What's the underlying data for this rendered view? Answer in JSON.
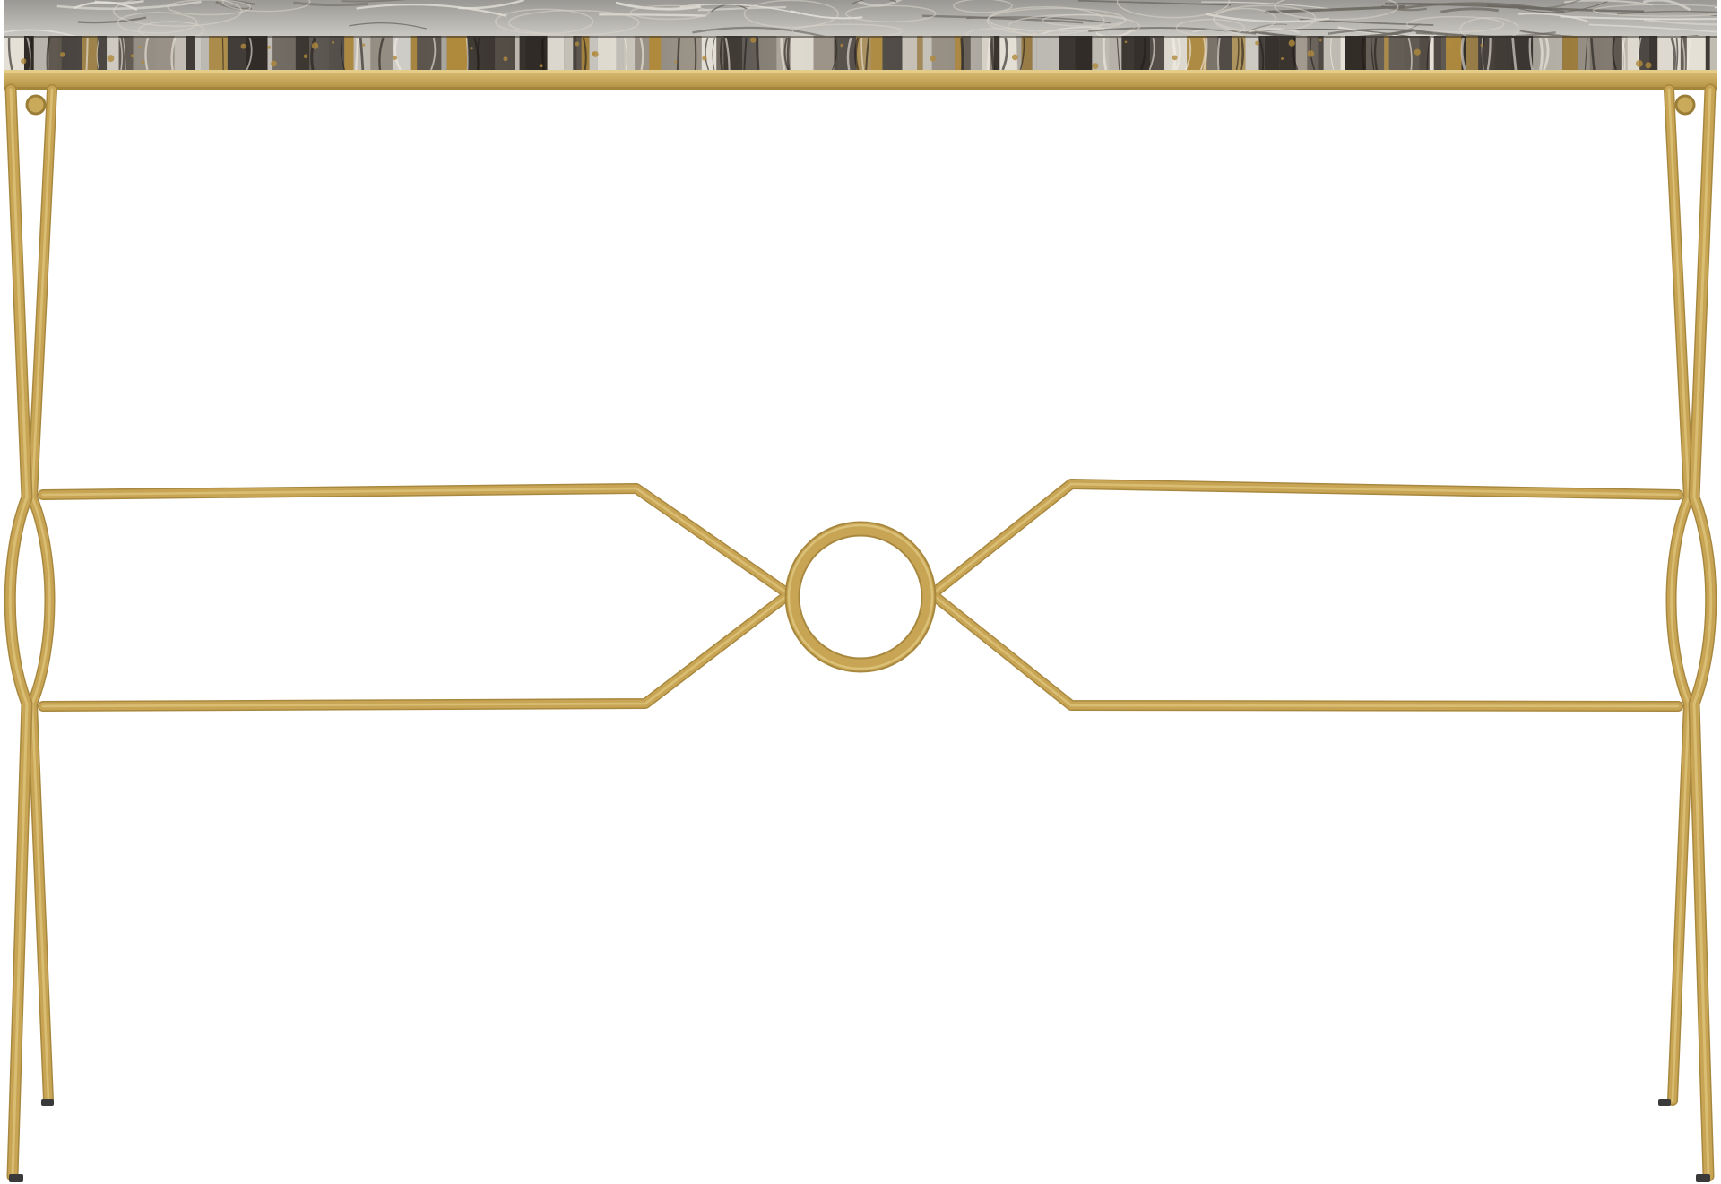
{
  "scene": {
    "subject": "console-table",
    "background_color": "#ffffff",
    "colors": {
      "gold": "#c8a554",
      "gold_dark": "#a8883f",
      "gold_light": "#e0c880",
      "agate_base": "#8e8e8c",
      "agate_dark": "#3a3531",
      "agate_light": "#d4d2cc",
      "agate_amber": "#b08a3c",
      "foot": "#3a3a3a"
    }
  }
}
